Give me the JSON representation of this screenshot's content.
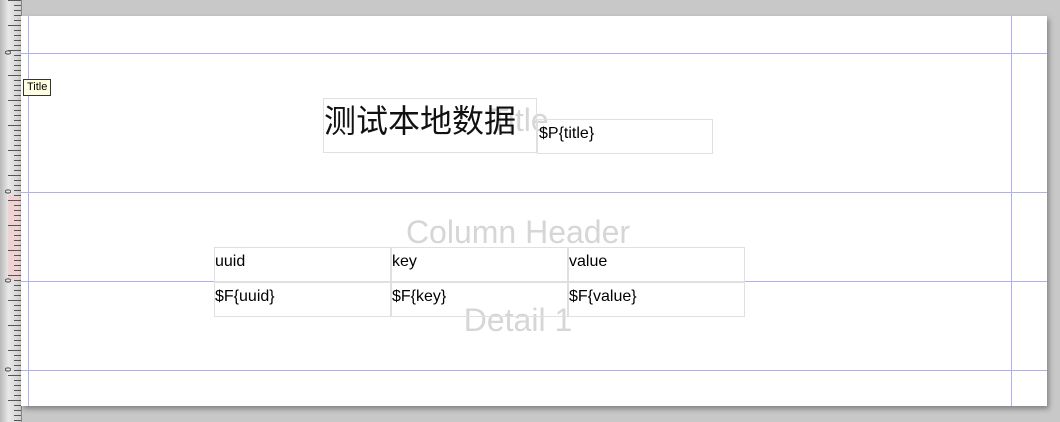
{
  "band_labels": {
    "title": "Title",
    "column_header": "Column Header",
    "detail": "Detail 1"
  },
  "tooltip": "Title",
  "title_band": {
    "static_text": "测试本地数据",
    "param_field": "$P{title}"
  },
  "column_headers": [
    "uuid",
    "key",
    "value"
  ],
  "detail_fields": [
    "$F{uuid}",
    "$F{key}",
    "$F{value}"
  ],
  "ruler": {
    "zero_label": "0"
  }
}
